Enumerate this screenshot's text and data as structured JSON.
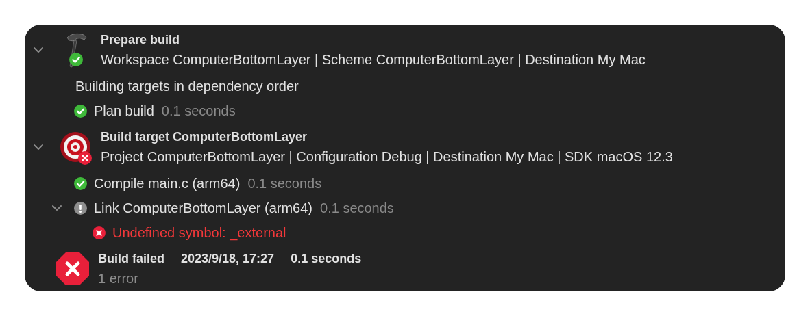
{
  "steps": [
    {
      "kind": "prepare",
      "status": {
        "kind": "success"
      },
      "expanded": true,
      "title": "Prepare build",
      "detail": "Workspace ComputerBottomLayer | Scheme ComputerBottomLayer | Destination My Mac",
      "children": [
        {
          "kind": "note",
          "text": "Building targets in dependency order"
        },
        {
          "kind": "task",
          "status": {
            "kind": "success"
          },
          "text": "Plan build",
          "duration": "0.1 seconds"
        }
      ]
    },
    {
      "kind": "target",
      "status": {
        "kind": "error"
      },
      "expanded": true,
      "title": "Build target ComputerBottomLayer",
      "detail": "Project ComputerBottomLayer | Configuration Debug | Destination My Mac | SDK macOS 12.3",
      "children": [
        {
          "kind": "task",
          "status": {
            "kind": "success"
          },
          "text": "Compile main.c (arm64)",
          "duration": "0.1 seconds"
        },
        {
          "kind": "task",
          "status": {
            "kind": "notice"
          },
          "expanded": true,
          "text": "Link ComputerBottomLayer (arm64)",
          "duration": "0.1 seconds",
          "children": [
            {
              "kind": "issue",
              "status": {
                "kind": "error"
              },
              "text": "Undefined symbol: _external"
            }
          ]
        }
      ]
    }
  ],
  "result": {
    "status": {
      "kind": "failed"
    },
    "title": "Build failed",
    "date": "2023/9/18, 17:27",
    "duration": "0.1 seconds",
    "summary": "1 error"
  }
}
